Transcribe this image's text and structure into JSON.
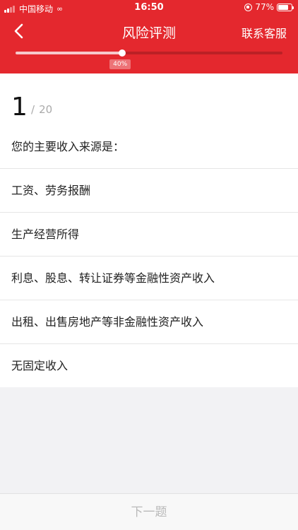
{
  "status_bar": {
    "carrier": "中国移动",
    "time": "16:50",
    "battery": "77%",
    "battery_level": 0.77
  },
  "nav": {
    "title": "风险评测",
    "contact_label": "联系客服"
  },
  "progress": {
    "value": 0.4,
    "label": "40%"
  },
  "question": {
    "number": "1",
    "separator": "/",
    "total": "20",
    "text": "您的主要收入来源是："
  },
  "options": [
    "工资、劳务报酬",
    "生产经营所得",
    "利息、股息、转让证券等金融性资产收入",
    "出租、出售房地产等非金融性资产收入",
    "无固定收入"
  ],
  "footer": {
    "next_label": "下一题"
  },
  "colors": {
    "header": "#e4282e",
    "next_disabled": "#b9b9b9"
  }
}
